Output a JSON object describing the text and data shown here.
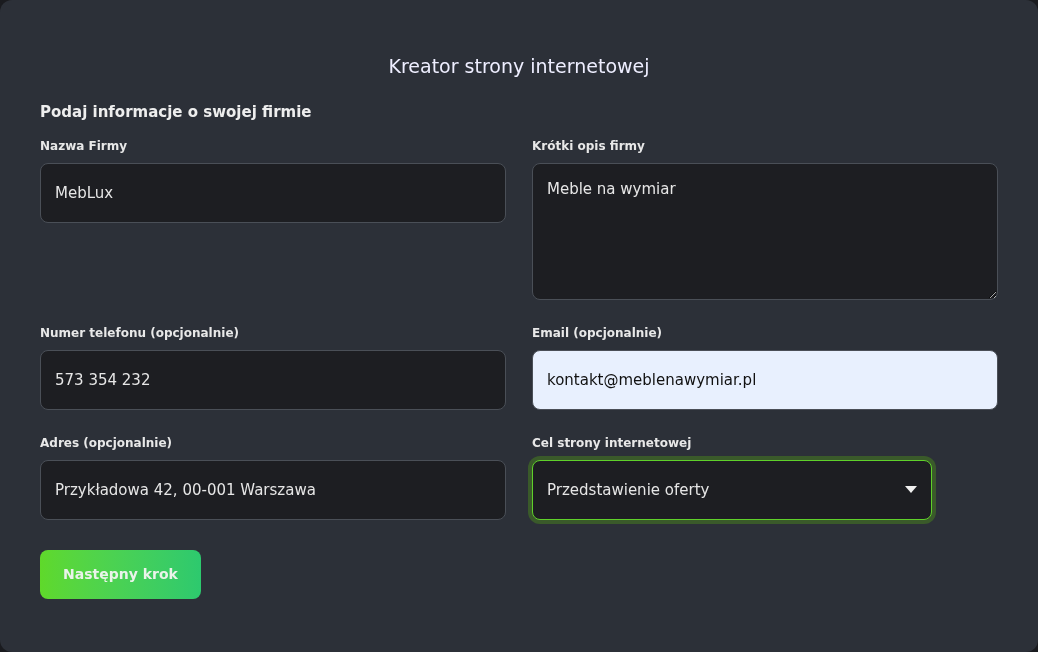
{
  "title": "Kreator strony internetowej",
  "section_heading": "Podaj informacje o swojej firmie",
  "fields": [
    {
      "kind": "input",
      "label": "Nazwa Firmy",
      "value": "MebLux",
      "autofilled": false,
      "focused": false
    },
    {
      "kind": "textarea",
      "label": "Krótki opis firmy",
      "value": "Meble na wymiar",
      "autofilled": false,
      "focused": false
    },
    {
      "kind": "input",
      "label": "Numer telefonu (opcjonalnie)",
      "value": "573 354 232",
      "autofilled": false,
      "focused": false
    },
    {
      "kind": "input",
      "label": "Email (opcjonalnie)",
      "value": "kontakt@meblenawymiar.pl",
      "autofilled": true,
      "focused": false
    },
    {
      "kind": "input",
      "label": "Adres (opcjonalnie)",
      "value": "Przykładowa 42, 00-001 Warszawa",
      "autofilled": false,
      "focused": false
    },
    {
      "kind": "select",
      "label": "Cel strony internetowej",
      "value": "Przedstawienie oferty",
      "autofilled": false,
      "focused": true
    }
  ],
  "next_button": "Następny krok"
}
